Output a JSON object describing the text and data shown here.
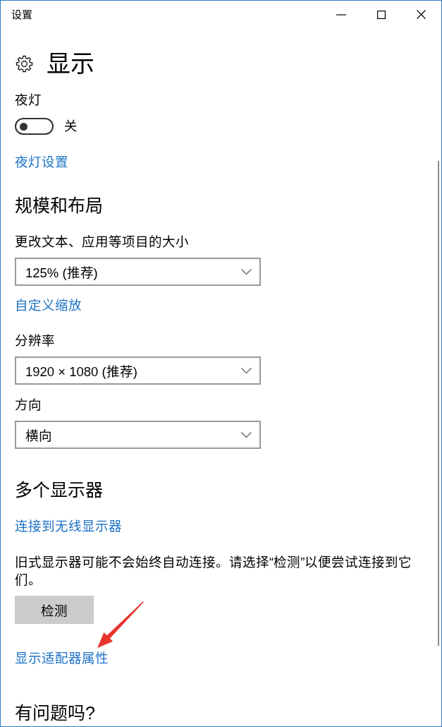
{
  "window": {
    "title": "设置"
  },
  "page": {
    "title": "显示"
  },
  "content": [
    {
      "kind": "label",
      "text": "夜灯"
    },
    {
      "kind": "toggle",
      "on": false,
      "state_text": "关"
    },
    {
      "kind": "link",
      "text": "夜灯设置"
    },
    {
      "kind": "heading",
      "text": "规模和布局"
    },
    {
      "kind": "label",
      "text": "更改文本、应用等项目的大小"
    },
    {
      "kind": "dropdown",
      "value": "125% (推荐)"
    },
    {
      "kind": "link",
      "text": "自定义缩放"
    },
    {
      "kind": "label",
      "text": "分辨率"
    },
    {
      "kind": "dropdown",
      "value": "1920 × 1080 (推荐)"
    },
    {
      "kind": "label",
      "text": "方向"
    },
    {
      "kind": "dropdown",
      "value": "横向"
    },
    {
      "kind": "heading",
      "text": "多个显示器"
    },
    {
      "kind": "link",
      "text": "连接到无线显示器"
    },
    {
      "kind": "paragraph",
      "text": "旧式显示器可能不会始终自动连接。请选择“检测”以便尝试连接到它们。"
    },
    {
      "kind": "button",
      "text": "检测"
    },
    {
      "kind": "link",
      "text": "显示适配器属性"
    },
    {
      "kind": "heading",
      "text": "有问题吗?"
    }
  ],
  "annotation": {
    "kind": "arrow"
  }
}
